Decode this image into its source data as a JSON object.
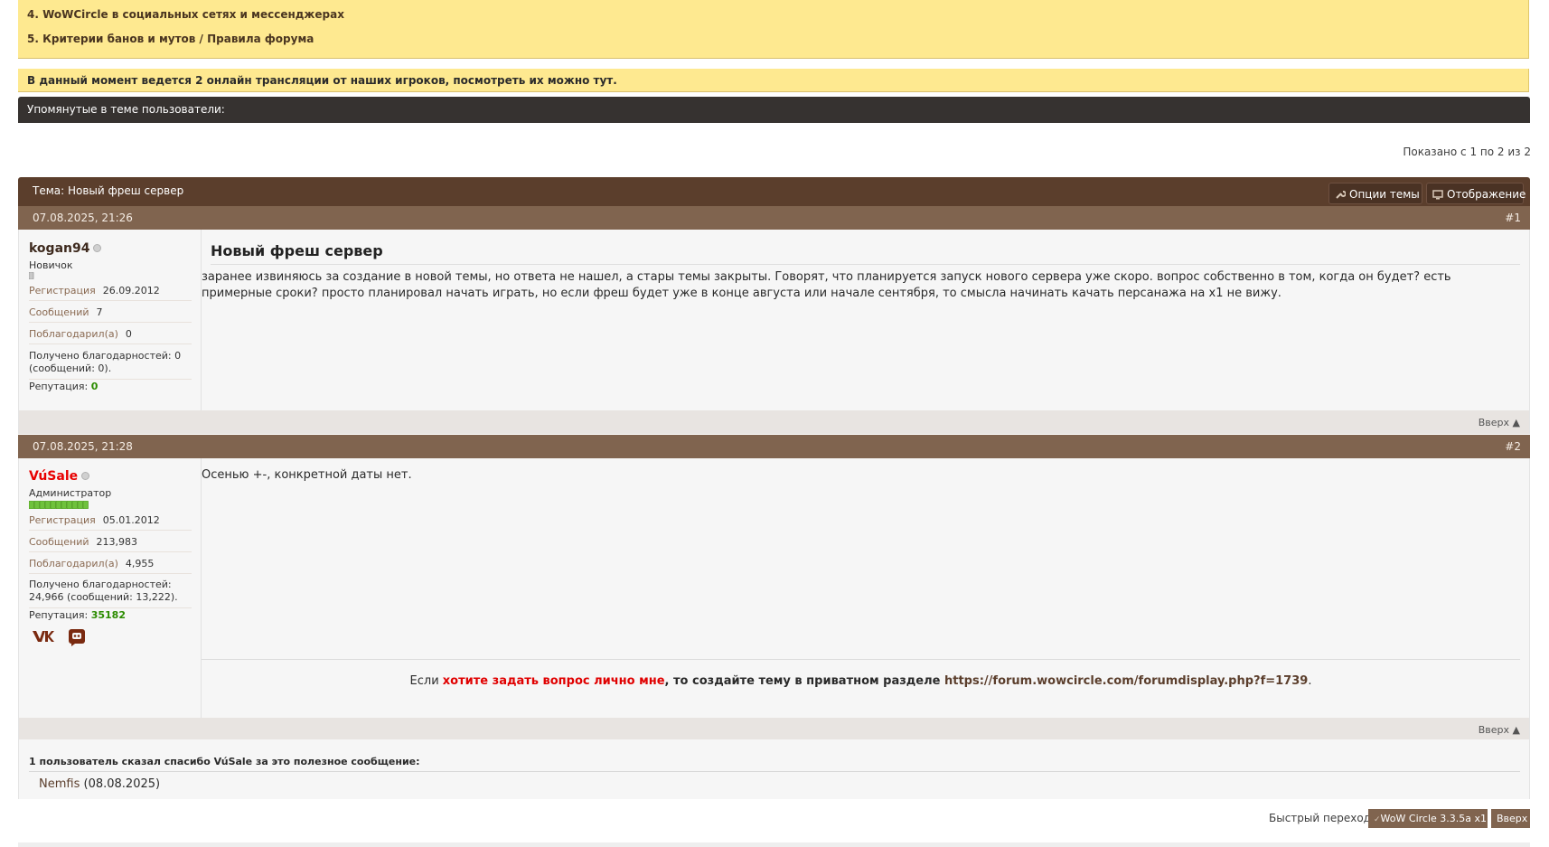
{
  "notices": {
    "links": [
      "4. WoWCircle в социальных сетях и мессенджерах",
      "5. Критерии банов и мутов / Правила форума"
    ],
    "stream_text": "В данный момент ведется 2 онлайн трансляции от наших игроков, посмотреть их можно тут."
  },
  "mentioned_label": "Упомянутые в теме пользователи:",
  "pagination_text": "Показано с 1 по 2 из 2",
  "thread": {
    "title": "Тема: Новый фреш сервер",
    "options_label": "Опции темы",
    "display_label": "Отображение"
  },
  "posts": [
    {
      "date": "07.08.2025, 21:26",
      "number": "#1",
      "username": "kogan94",
      "rank": "Новичок",
      "reg_label": "Регистрация",
      "reg_value": "26.09.2012",
      "posts_label": "Сообщений",
      "posts_value": "7",
      "thanked_label": "Поблагодарил(а)",
      "thanked_value": "0",
      "received_line1": "Получено благодарностей: 0",
      "received_line2": "(сообщений: 0).",
      "rep_label": "Репутация:",
      "rep_value": "0",
      "title": "Новый фреш сервер",
      "text": "заранее извиняюсь за создание в новой темы, но ответа не нашел, а стары темы закрыты. Говорят, что планируется запуск нового сервера уже скоро. вопрос собственно в том, когда он будет? есть примерные сроки? просто планировал начать играть, но если фреш будет уже в конце августа или начале сентября, то смысла начинать качать персанажа на х1 не вижу.",
      "up_label": "Вверх ▲"
    },
    {
      "date": "07.08.2025, 21:28",
      "number": "#2",
      "username": "VúSale",
      "rank": "Администратор",
      "reg_label": "Регистрация",
      "reg_value": "05.01.2012",
      "posts_label": "Сообщений",
      "posts_value": "213,983",
      "thanked_label": "Поблагодарил(а)",
      "thanked_value": "4,955",
      "received_line1": "Получено благодарностей:",
      "received_line2": "24,966 (сообщений: 13,222).",
      "rep_label": "Репутация:",
      "rep_value": "35182",
      "text": "Осенью +-, конкретной даты нет.",
      "signature": {
        "pre": "Если ",
        "red": "хотите задать вопрос лично мне",
        "mid": ", то создайте тему в приватном разделе ",
        "link": "https://forum.wowcircle.com/forumdisplay.php?f=1739",
        "post": "."
      },
      "social_icons": [
        "vk-icon",
        "discord-icon"
      ],
      "up_label": "Вверх ▲"
    }
  ],
  "thanks": {
    "title": "1 пользователь сказал спасибо VúSale за это полезное сообщение:",
    "user": "Nemfis",
    "date": "(08.08.2025)"
  },
  "footer": {
    "quick_nav_label": "Быстрый переход",
    "forum_button": "WoW Circle 3.3.5a x1",
    "top_button": "Вверх"
  },
  "colors": {
    "notice_bg": "#fee990",
    "header_dark": "#363230",
    "thread_head": "#5b3e2c",
    "post_bar": "#80644f",
    "admin_name": "#e80000",
    "reputation": "#2b8c00"
  }
}
